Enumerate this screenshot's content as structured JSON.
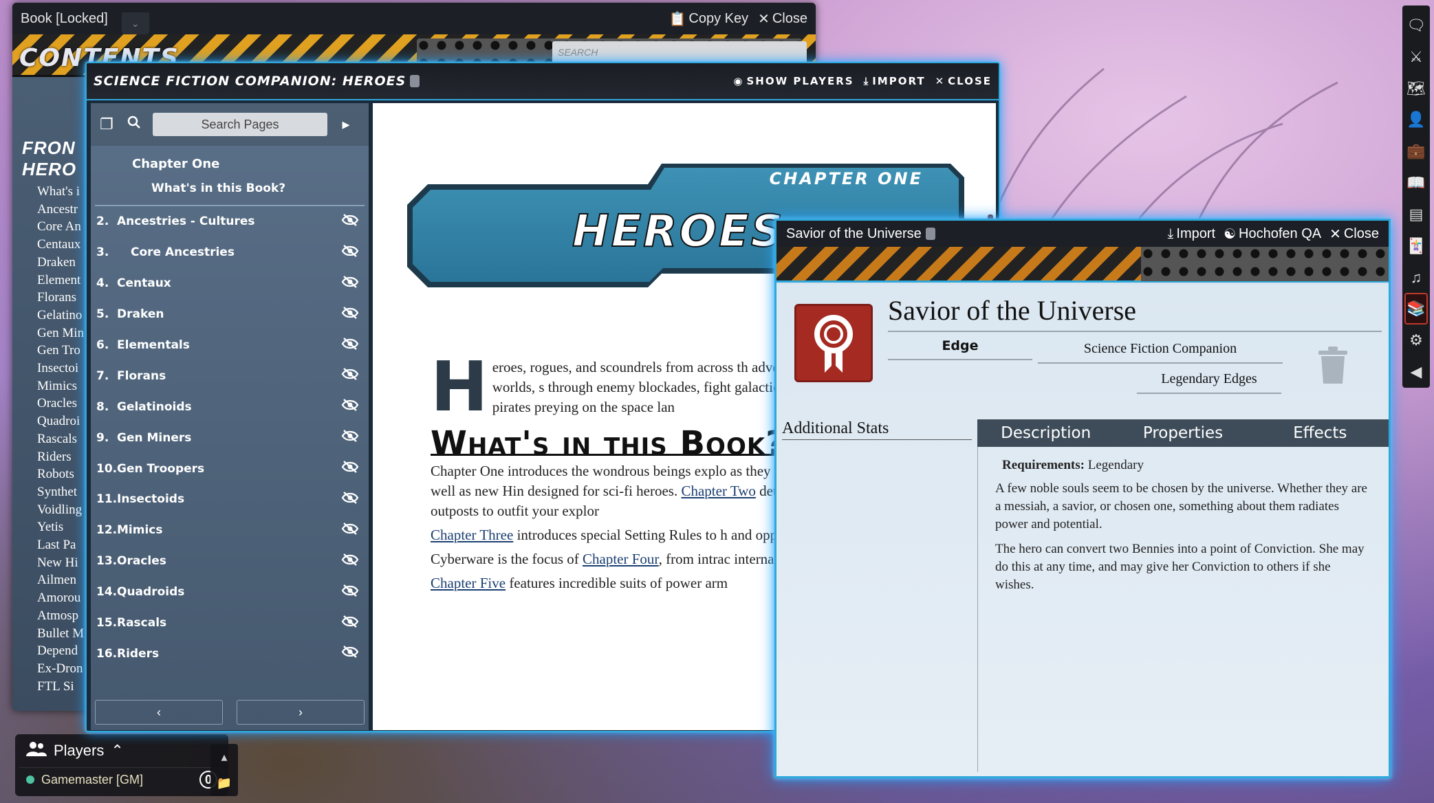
{
  "book_window": {
    "title": "Book [Locked]",
    "copy_key_label": "Copy Key",
    "close_label": "Close",
    "contents_label": "CONTENTS",
    "search_placeholder": "SEARCH",
    "headings": [
      "FRON",
      "HERO"
    ],
    "items": [
      "What's i",
      "Ancestr",
      "Core An",
      "Centaux",
      "Draken",
      "Element",
      "Florans",
      "Gelatino",
      "Gen Min",
      "Gen Tro",
      "Insectoi",
      "Mimics",
      "Oracles",
      "Quadroi",
      "Rascals",
      "Riders",
      "Robots",
      "Synthet",
      "Voidling",
      "Yetis",
      "Last Pa",
      "New Hi",
      "Ailmen",
      "Amorou",
      "Atmosp",
      "Bullet M",
      "Depend",
      "Ex-Dron",
      "FTL Si"
    ]
  },
  "players": {
    "title": "Players",
    "gm_name": "Gamemaster [GM]",
    "gm_count": "0"
  },
  "sf_window": {
    "title": "Science Fiction Companion: Heroes",
    "show_players_label": "Show Players",
    "import_label": "Import",
    "close_label": "Close",
    "search_placeholder": "Search Pages",
    "chapter_label": "Chapter One",
    "sub_label": "What's in this Book?",
    "toc": [
      {
        "num": "2.",
        "label": "Ancestries - Cultures",
        "indent": false
      },
      {
        "num": "3.",
        "label": "Core Ancestries",
        "indent": true
      },
      {
        "num": "4.",
        "label": "Centaux",
        "indent": false
      },
      {
        "num": "5.",
        "label": "Draken",
        "indent": false
      },
      {
        "num": "6.",
        "label": "Elementals",
        "indent": false
      },
      {
        "num": "7.",
        "label": "Florans",
        "indent": false
      },
      {
        "num": "8.",
        "label": "Gelatinoids",
        "indent": false
      },
      {
        "num": "9.",
        "label": "Gen Miners",
        "indent": false
      },
      {
        "num": "10.",
        "label": "Gen Troopers",
        "indent": false
      },
      {
        "num": "11.",
        "label": "Insectoids",
        "indent": false
      },
      {
        "num": "12.",
        "label": "Mimics",
        "indent": false
      },
      {
        "num": "13.",
        "label": "Oracles",
        "indent": false
      },
      {
        "num": "14.",
        "label": "Quadroids",
        "indent": false
      },
      {
        "num": "15.",
        "label": "Rascals",
        "indent": false
      },
      {
        "num": "16.",
        "label": "Riders",
        "indent": false
      }
    ],
    "page": {
      "chapter_banner": "CHAPTER ONE",
      "banner_title": "HEROES",
      "drop_cap": "H",
      "intro": "eroes, rogues, and scoundrels from across th adventure. They explore unknown worlds, s through enemy blockades, fight galactic war and battle ruthless pirates preying on the space lan",
      "heading": "What's in this Book?",
      "p1_a": "Chapter One introduces the wondrous beings explo as they travel across the galaxy, as well as new Hin designed for sci-fi heroes. ",
      "p1_link": "Chapter Two",
      "p1_b": " details futu armor, weapons, and outposts to outfit your explor",
      "p2_link": "Chapter Three",
      "p2_b": " introduces special Setting Rules to h and opportunities—of the future.",
      "p3_a": "Cyberware is the focus of ",
      "p3_link": "Chapter Four",
      "p3_b": ", from intrac internal weapons.",
      "p4_link": "Chapter Five",
      "p4_b": " features incredible suits of power arm"
    }
  },
  "edge_window": {
    "title": "Savior of the Universe",
    "import_label": "Import",
    "hochofen_label": "Hochofen QA",
    "close_label": "Close",
    "name": "Savior of the Universe",
    "type": "Edge",
    "source": "Science Fiction Companion",
    "category": "Legendary Edges",
    "additional_stats_label": "Additional Stats",
    "tabs": [
      "Description",
      "Properties",
      "Effects"
    ],
    "requirements_label": "Requirements:",
    "requirements_value": "Legendary",
    "desc_p1": "A few noble souls seem to be chosen by the universe. Whether they are a messiah, a savior, or chosen one, something about them radiates power and potential.",
    "desc_p2": "The hero can convert two Bennies into a point of Conviction. She may do this at any time, and may give her Conviction to others if she wishes."
  },
  "toolbar": {
    "icons": [
      "chat-icon",
      "combat-icon",
      "map-icon",
      "actor-icon",
      "item-icon",
      "journal-icon",
      "table-icon",
      "cards-icon",
      "music-icon",
      "compendium-icon",
      "settings-icon",
      "collapse-icon"
    ]
  },
  "colors": {
    "accent_glow": "#2fa8dc",
    "edge_icon": "#a52a22",
    "tab_bar": "#3e4c5a"
  }
}
